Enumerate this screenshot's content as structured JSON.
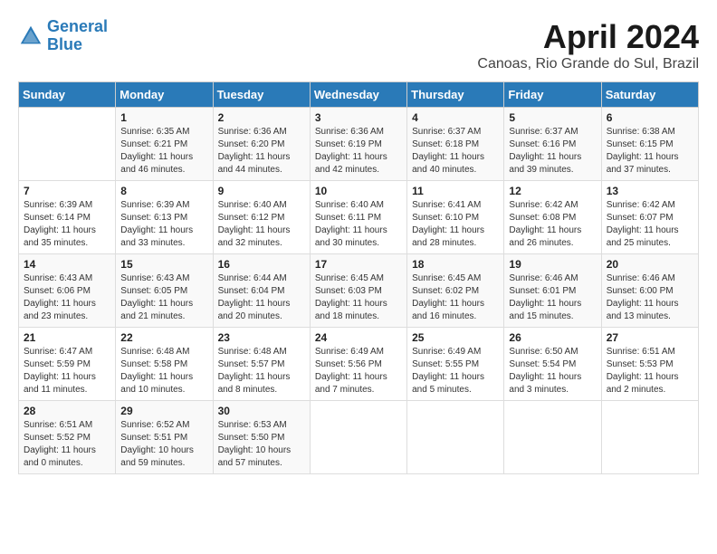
{
  "header": {
    "logo_line1": "General",
    "logo_line2": "Blue",
    "month": "April 2024",
    "location": "Canoas, Rio Grande do Sul, Brazil"
  },
  "weekdays": [
    "Sunday",
    "Monday",
    "Tuesday",
    "Wednesday",
    "Thursday",
    "Friday",
    "Saturday"
  ],
  "weeks": [
    [
      {
        "day": "",
        "info": ""
      },
      {
        "day": "1",
        "info": "Sunrise: 6:35 AM\nSunset: 6:21 PM\nDaylight: 11 hours\nand 46 minutes."
      },
      {
        "day": "2",
        "info": "Sunrise: 6:36 AM\nSunset: 6:20 PM\nDaylight: 11 hours\nand 44 minutes."
      },
      {
        "day": "3",
        "info": "Sunrise: 6:36 AM\nSunset: 6:19 PM\nDaylight: 11 hours\nand 42 minutes."
      },
      {
        "day": "4",
        "info": "Sunrise: 6:37 AM\nSunset: 6:18 PM\nDaylight: 11 hours\nand 40 minutes."
      },
      {
        "day": "5",
        "info": "Sunrise: 6:37 AM\nSunset: 6:16 PM\nDaylight: 11 hours\nand 39 minutes."
      },
      {
        "day": "6",
        "info": "Sunrise: 6:38 AM\nSunset: 6:15 PM\nDaylight: 11 hours\nand 37 minutes."
      }
    ],
    [
      {
        "day": "7",
        "info": "Sunrise: 6:39 AM\nSunset: 6:14 PM\nDaylight: 11 hours\nand 35 minutes."
      },
      {
        "day": "8",
        "info": "Sunrise: 6:39 AM\nSunset: 6:13 PM\nDaylight: 11 hours\nand 33 minutes."
      },
      {
        "day": "9",
        "info": "Sunrise: 6:40 AM\nSunset: 6:12 PM\nDaylight: 11 hours\nand 32 minutes."
      },
      {
        "day": "10",
        "info": "Sunrise: 6:40 AM\nSunset: 6:11 PM\nDaylight: 11 hours\nand 30 minutes."
      },
      {
        "day": "11",
        "info": "Sunrise: 6:41 AM\nSunset: 6:10 PM\nDaylight: 11 hours\nand 28 minutes."
      },
      {
        "day": "12",
        "info": "Sunrise: 6:42 AM\nSunset: 6:08 PM\nDaylight: 11 hours\nand 26 minutes."
      },
      {
        "day": "13",
        "info": "Sunrise: 6:42 AM\nSunset: 6:07 PM\nDaylight: 11 hours\nand 25 minutes."
      }
    ],
    [
      {
        "day": "14",
        "info": "Sunrise: 6:43 AM\nSunset: 6:06 PM\nDaylight: 11 hours\nand 23 minutes."
      },
      {
        "day": "15",
        "info": "Sunrise: 6:43 AM\nSunset: 6:05 PM\nDaylight: 11 hours\nand 21 minutes."
      },
      {
        "day": "16",
        "info": "Sunrise: 6:44 AM\nSunset: 6:04 PM\nDaylight: 11 hours\nand 20 minutes."
      },
      {
        "day": "17",
        "info": "Sunrise: 6:45 AM\nSunset: 6:03 PM\nDaylight: 11 hours\nand 18 minutes."
      },
      {
        "day": "18",
        "info": "Sunrise: 6:45 AM\nSunset: 6:02 PM\nDaylight: 11 hours\nand 16 minutes."
      },
      {
        "day": "19",
        "info": "Sunrise: 6:46 AM\nSunset: 6:01 PM\nDaylight: 11 hours\nand 15 minutes."
      },
      {
        "day": "20",
        "info": "Sunrise: 6:46 AM\nSunset: 6:00 PM\nDaylight: 11 hours\nand 13 minutes."
      }
    ],
    [
      {
        "day": "21",
        "info": "Sunrise: 6:47 AM\nSunset: 5:59 PM\nDaylight: 11 hours\nand 11 minutes."
      },
      {
        "day": "22",
        "info": "Sunrise: 6:48 AM\nSunset: 5:58 PM\nDaylight: 11 hours\nand 10 minutes."
      },
      {
        "day": "23",
        "info": "Sunrise: 6:48 AM\nSunset: 5:57 PM\nDaylight: 11 hours\nand 8 minutes."
      },
      {
        "day": "24",
        "info": "Sunrise: 6:49 AM\nSunset: 5:56 PM\nDaylight: 11 hours\nand 7 minutes."
      },
      {
        "day": "25",
        "info": "Sunrise: 6:49 AM\nSunset: 5:55 PM\nDaylight: 11 hours\nand 5 minutes."
      },
      {
        "day": "26",
        "info": "Sunrise: 6:50 AM\nSunset: 5:54 PM\nDaylight: 11 hours\nand 3 minutes."
      },
      {
        "day": "27",
        "info": "Sunrise: 6:51 AM\nSunset: 5:53 PM\nDaylight: 11 hours\nand 2 minutes."
      }
    ],
    [
      {
        "day": "28",
        "info": "Sunrise: 6:51 AM\nSunset: 5:52 PM\nDaylight: 11 hours\nand 0 minutes."
      },
      {
        "day": "29",
        "info": "Sunrise: 6:52 AM\nSunset: 5:51 PM\nDaylight: 10 hours\nand 59 minutes."
      },
      {
        "day": "30",
        "info": "Sunrise: 6:53 AM\nSunset: 5:50 PM\nDaylight: 10 hours\nand 57 minutes."
      },
      {
        "day": "",
        "info": ""
      },
      {
        "day": "",
        "info": ""
      },
      {
        "day": "",
        "info": ""
      },
      {
        "day": "",
        "info": ""
      }
    ]
  ]
}
